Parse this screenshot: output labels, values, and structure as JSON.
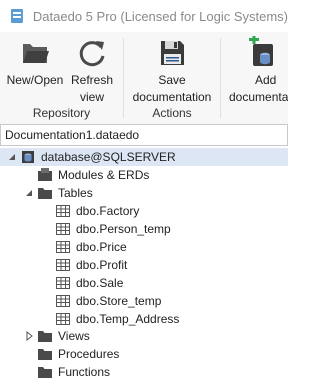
{
  "titlebar": {
    "title": "Dataedo 5 Pro (Licensed for Logic Systems)"
  },
  "ribbon": {
    "groups": [
      {
        "label": "Repository",
        "buttons": [
          {
            "label1": "New/Open",
            "label2": ""
          },
          {
            "label1": "Refresh",
            "label2": "view"
          }
        ]
      },
      {
        "label": "Actions",
        "buttons": [
          {
            "label1": "Save",
            "label2": "documentation"
          }
        ]
      },
      {
        "label": "",
        "buttons": [
          {
            "label1": "Add",
            "label2": "documentation"
          }
        ]
      }
    ]
  },
  "document": {
    "name": "Documentation1.dataedo"
  },
  "tree": {
    "database": "database@SQLSERVER",
    "modules": "Modules & ERDs",
    "tables": "Tables",
    "table_items": [
      "dbo.Factory",
      "dbo.Person_temp",
      "dbo.Price",
      "dbo.Profit",
      "dbo.Sale",
      "dbo.Store_temp",
      "dbo.Temp_Address"
    ],
    "views": "Views",
    "procedures": "Procedures",
    "functions": "Functions"
  },
  "colors": {
    "accent": "#2b5797",
    "folder": "#4a4a4a",
    "selection": "#dde6f5"
  }
}
